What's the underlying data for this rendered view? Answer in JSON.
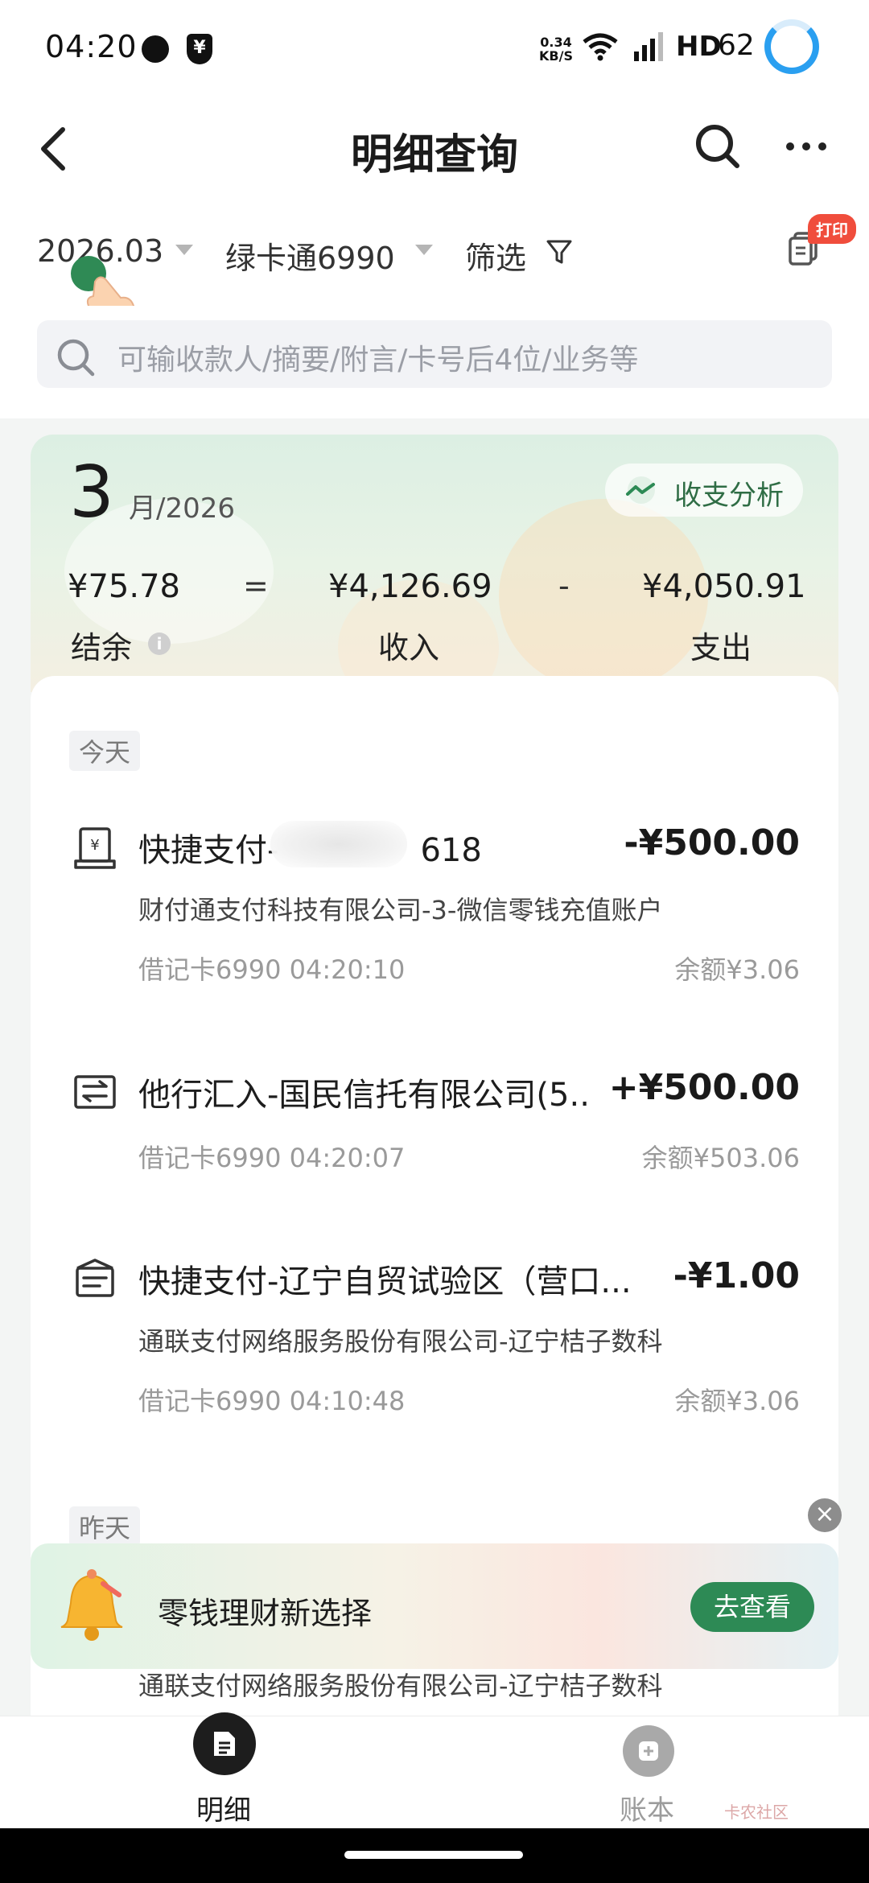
{
  "status_bar": {
    "time": "04:20",
    "net_speed_value": "0.34",
    "net_speed_unit": "KB/S",
    "hd": "HD",
    "battery": "62"
  },
  "header": {
    "title": "明细查询"
  },
  "filters": {
    "month": "2026.03",
    "card": "绿卡通6990",
    "screen": "筛选",
    "print_badge": "打印"
  },
  "search": {
    "placeholder": "可输收款人/摘要/附言/卡号后4位/业务等"
  },
  "summary": {
    "month": "3",
    "month_suffix": "月/2026",
    "analysis_label": "收支分析",
    "balance": "¥75.78",
    "equals": "=",
    "income": "¥4,126.69",
    "minus": "-",
    "expense": "¥4,050.91",
    "balance_label": "结余",
    "income_label": "收入",
    "expense_label": "支出"
  },
  "transactions": {
    "today_label": "今天",
    "yesterday_label": "昨天",
    "items": [
      {
        "title_prefix": "快捷支付-",
        "title_suffix": "618)",
        "amount": "-¥500.00",
        "desc": "财付通支付科技有限公司-3-微信零钱充值账户",
        "meta": "借记卡6990 04:20:10",
        "balance": "余额¥3.06"
      },
      {
        "title": "他行汇入-国民信托有限公司(5...",
        "amount": "+¥500.00",
        "meta": "借记卡6990 04:20:07",
        "balance": "余额¥503.06"
      },
      {
        "title": "快捷支付-辽宁自贸试验区（营口...",
        "amount": "-¥1.00",
        "desc": "通联支付网络服务股份有限公司-辽宁桔子数科",
        "meta": "借记卡6990 04:10:48",
        "balance": "余额¥3.06"
      },
      {
        "desc": "通联支付网络服务股份有限公司-辽宁桔子数科"
      }
    ]
  },
  "promo": {
    "text": "零钱理财新选择",
    "button": "去查看"
  },
  "bottom_nav": {
    "detail_label": "明细",
    "book_label": "账本",
    "watermark": "卡农社区"
  },
  "colors": {
    "accent_green": "#2d8a55",
    "badge_red": "#f04d3c",
    "status_ring_blue": "#2a9ff0"
  }
}
